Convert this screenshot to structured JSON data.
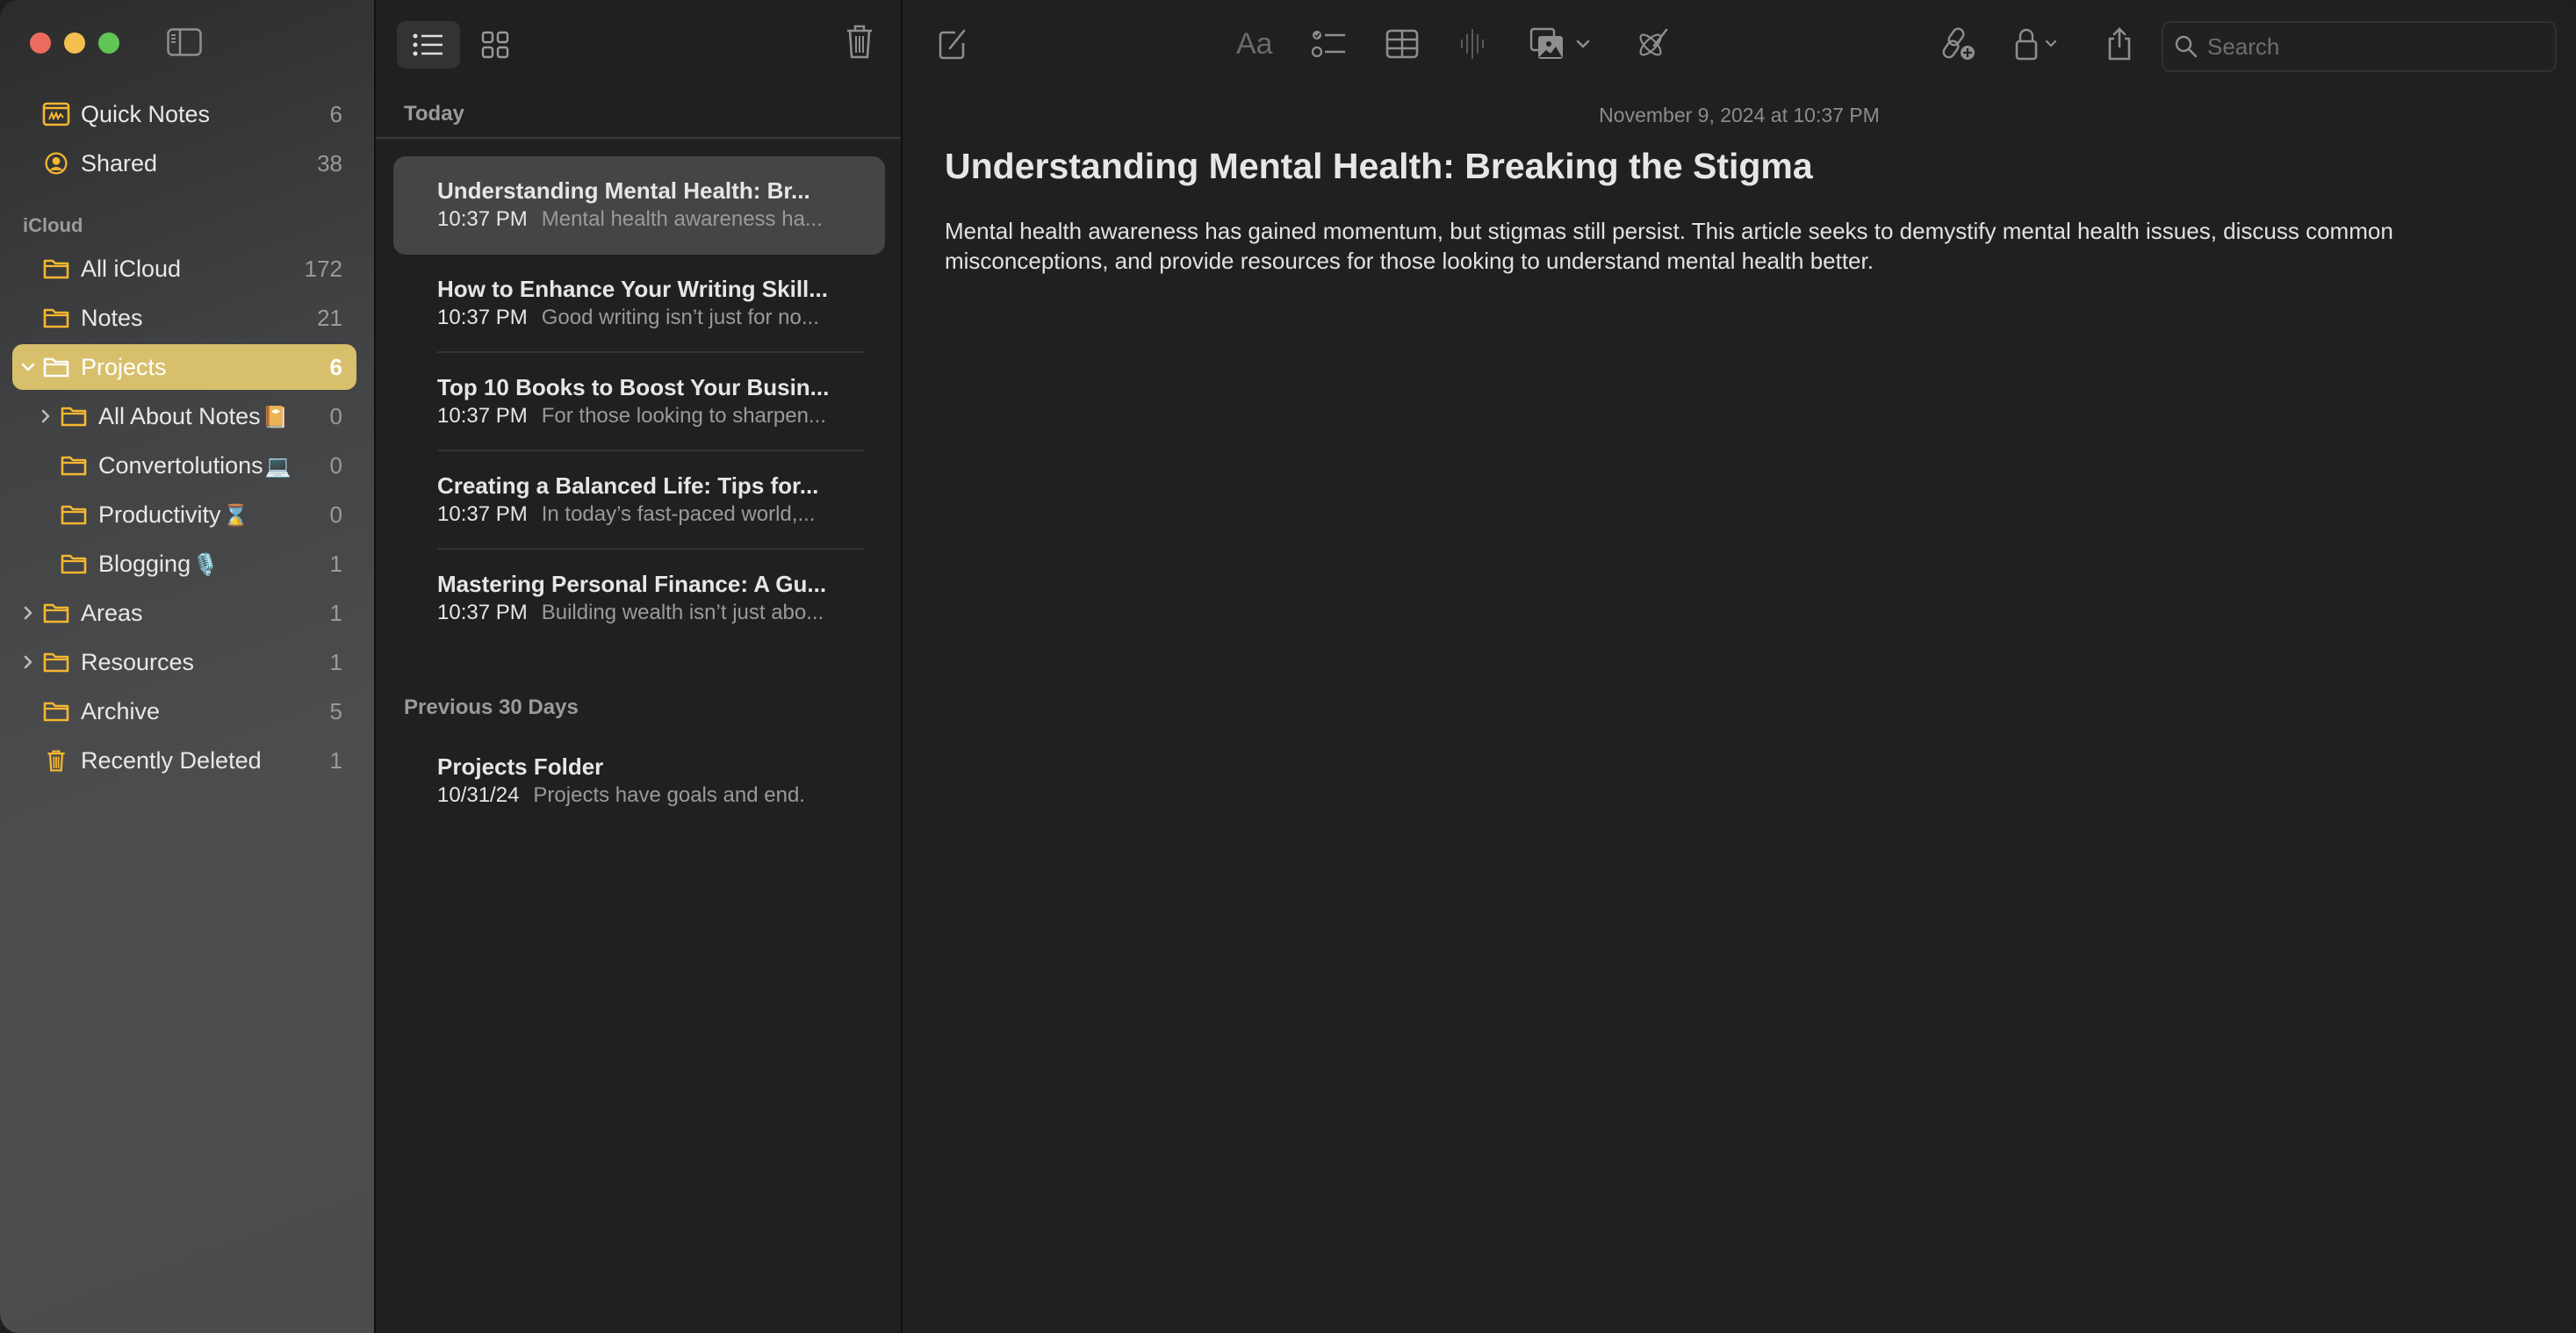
{
  "window": {
    "controls": [
      "close",
      "minimize",
      "maximize"
    ]
  },
  "sidebar": {
    "top_items": [
      {
        "label": "Quick Notes",
        "count": "6",
        "icon": "quick-notes-icon"
      },
      {
        "label": "Shared",
        "count": "38",
        "icon": "shared-person-icon"
      }
    ],
    "section_label": "iCloud",
    "folders": [
      {
        "label": "All iCloud",
        "count": "172",
        "icon": "folder-icon"
      },
      {
        "label": "Notes",
        "count": "21",
        "icon": "folder-icon"
      },
      {
        "label": "Projects",
        "count": "6",
        "icon": "folder-icon",
        "selected": true,
        "expanded": true
      },
      {
        "label": "All About Notes",
        "emoji": "📔",
        "count": "0",
        "icon": "folder-icon",
        "collapsed": true
      },
      {
        "label": "Convertolutions",
        "emoji": "💻",
        "count": "0",
        "icon": "folder-icon"
      },
      {
        "label": "Productivity",
        "emoji": "⌛",
        "count": "0",
        "icon": "folder-icon"
      },
      {
        "label": "Blogging",
        "emoji": "🎙️",
        "count": "1",
        "icon": "folder-icon"
      },
      {
        "label": "Areas",
        "count": "1",
        "icon": "folder-icon",
        "collapsed": true
      },
      {
        "label": "Resources",
        "count": "1",
        "icon": "folder-icon",
        "collapsed": true
      },
      {
        "label": "Archive",
        "count": "5",
        "icon": "folder-icon"
      },
      {
        "label": "Recently Deleted",
        "count": "1",
        "icon": "trash-icon"
      }
    ]
  },
  "note_list": {
    "view_modes": [
      "list",
      "gallery"
    ],
    "active_view": "list",
    "groups": [
      {
        "header": "Today",
        "notes": [
          {
            "title": "Understanding Mental Health: Br...",
            "time": "10:37 PM",
            "snippet": "Mental health awareness ha...",
            "selected": true
          },
          {
            "title": "How to Enhance Your Writing Skill...",
            "time": "10:37 PM",
            "snippet": "Good writing isn’t just for no..."
          },
          {
            "title": "Top 10 Books to Boost Your Busin...",
            "time": "10:37 PM",
            "snippet": "For those looking to sharpen..."
          },
          {
            "title": "Creating a Balanced Life: Tips for...",
            "time": "10:37 PM",
            "snippet": "In today’s fast-paced world,..."
          },
          {
            "title": "Mastering Personal Finance: A Gu...",
            "time": "10:37 PM",
            "snippet": "Building wealth isn’t just abo..."
          }
        ]
      },
      {
        "header": "Previous 30 Days",
        "notes": [
          {
            "title": "Projects Folder",
            "time": "10/31/24",
            "snippet": "Projects have goals and end."
          }
        ]
      }
    ]
  },
  "toolbar": {
    "icons": [
      "compose-icon",
      "text-format-icon",
      "checklist-icon",
      "table-icon",
      "audio-waveform-icon",
      "media-icon",
      "writing-tools-icon",
      "collaborate-icon",
      "lock-icon",
      "share-icon"
    ],
    "search_placeholder": "Search",
    "search_value": ""
  },
  "editor": {
    "date": "November 9, 2024 at 10:37 PM",
    "title": "Understanding Mental Health: Breaking the Stigma",
    "body": "Mental health awareness has gained momentum, but stigmas still persist. This article seeks to demystify mental health issues, discuss common misconceptions, and provide resources for those looking to understand mental health better."
  },
  "colors": {
    "accent": "#f5b731",
    "selection": "#d8bf6b",
    "background": "#202020"
  }
}
